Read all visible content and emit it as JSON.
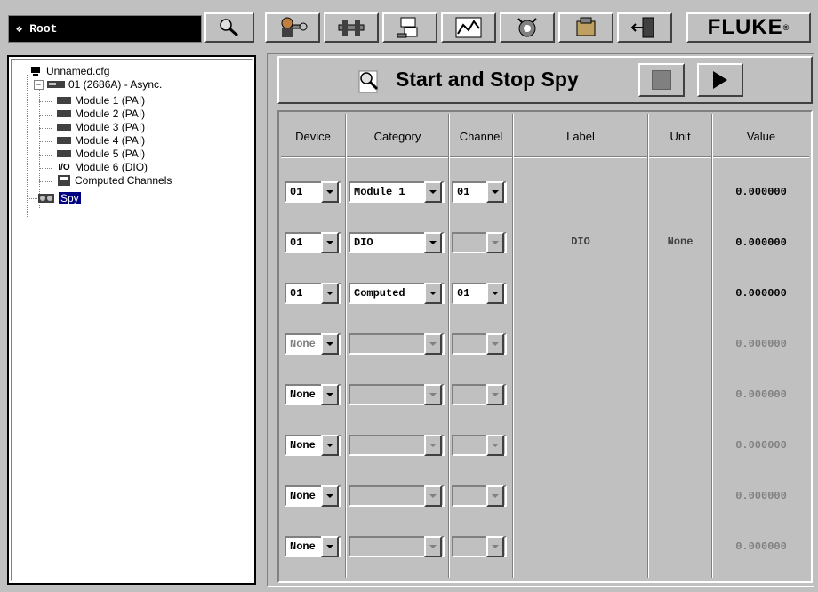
{
  "toolbar": {
    "root_label": "Root",
    "buttons": [
      "search-icon",
      "wrench-user-icon",
      "network-tools-icon",
      "computers-icon",
      "chart-icon",
      "alarm-icon",
      "module-icon",
      "exit-door-icon"
    ],
    "brand": "FLUKE",
    "brand_mark": "®"
  },
  "tree": {
    "root": "Unnamed.cfg",
    "instrument": "01 (2686A) - Async.",
    "modules": [
      "Module 1 (PAI)",
      "Module 2 (PAI)",
      "Module 3 (PAI)",
      "Module 4 (PAI)",
      "Module 5 (PAI)",
      "Module 6 (DIO)"
    ],
    "io_prefix": "I/O",
    "computed": "Computed Channels",
    "spy": "Spy"
  },
  "spy": {
    "title": "Start and Stop Spy",
    "columns": [
      "Device",
      "Category",
      "Channel",
      "Label",
      "Unit",
      "Value"
    ],
    "label_value": "DIO",
    "unit_value": "None",
    "rows": [
      {
        "device": "01",
        "category": "Module 1",
        "channel": "01",
        "value": "0.000000",
        "category_enabled": true,
        "channel_enabled": true,
        "active": true
      },
      {
        "device": "01",
        "category": "DIO",
        "channel": "",
        "value": "0.000000",
        "category_enabled": true,
        "channel_enabled": false,
        "active": true
      },
      {
        "device": "01",
        "category": "Computed",
        "channel": "01",
        "value": "0.000000",
        "category_enabled": true,
        "channel_enabled": true,
        "active": true
      },
      {
        "device": "None",
        "category": "",
        "channel": "",
        "value": "0.000000",
        "category_enabled": false,
        "channel_enabled": false,
        "active": false
      },
      {
        "device": "None",
        "category": "",
        "channel": "",
        "value": "0.000000",
        "category_enabled": false,
        "channel_enabled": false,
        "active": false
      },
      {
        "device": "None",
        "category": "",
        "channel": "",
        "value": "0.000000",
        "category_enabled": false,
        "channel_enabled": false,
        "active": false
      },
      {
        "device": "None",
        "category": "",
        "channel": "",
        "value": "0.000000",
        "category_enabled": false,
        "channel_enabled": false,
        "active": false
      },
      {
        "device": "None",
        "category": "",
        "channel": "",
        "value": "0.000000",
        "category_enabled": false,
        "channel_enabled": false,
        "active": false
      }
    ]
  }
}
